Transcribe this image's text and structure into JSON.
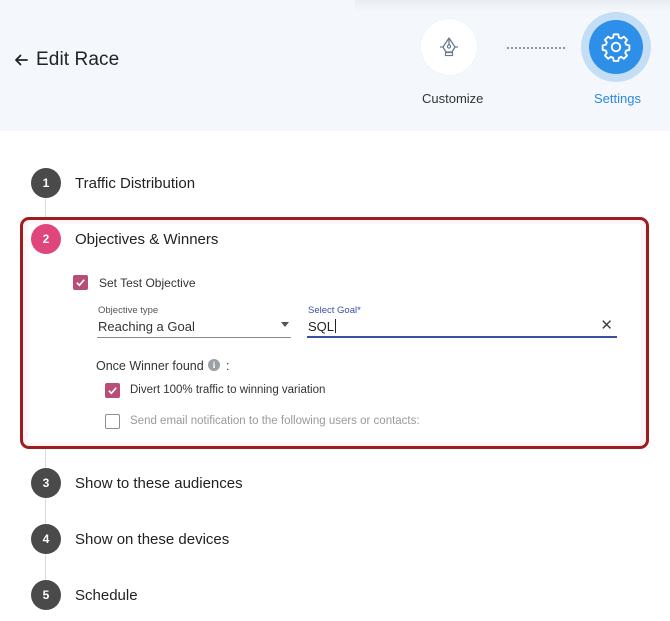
{
  "header": {
    "back_title": "Edit Race",
    "steps": [
      {
        "label": "Customize",
        "icon": "pen-tool-icon",
        "state": "inactive"
      },
      {
        "label": "Settings",
        "icon": "gear-icon",
        "state": "active"
      }
    ]
  },
  "colors": {
    "accent_blue": "#2e8fe8",
    "step_active": "#e0457b",
    "checkbox": "#b84d7a",
    "highlight_border": "#9e1c1c"
  },
  "sections": [
    {
      "number": "1",
      "title": "Traffic Distribution",
      "active": false
    },
    {
      "number": "2",
      "title": "Objectives & Winners",
      "active": true
    },
    {
      "number": "3",
      "title": "Show to these audiences",
      "active": false
    },
    {
      "number": "4",
      "title": "Show on these devices",
      "active": false
    },
    {
      "number": "5",
      "title": "Schedule",
      "active": false
    }
  ],
  "objectives": {
    "set_test_objective": {
      "label": "Set Test Objective",
      "checked": true
    },
    "objective_type": {
      "label": "Objective type",
      "value": "Reaching a Goal"
    },
    "select_goal": {
      "label": "Select Goal*",
      "value": "SQL"
    },
    "winner_heading": "Once Winner found",
    "winner_colon": ":",
    "info_glyph": "i",
    "divert": {
      "label": "Divert 100% traffic to winning variation",
      "checked": true
    },
    "email": {
      "label": "Send email notification to the following users or contacts:",
      "checked": false
    }
  }
}
